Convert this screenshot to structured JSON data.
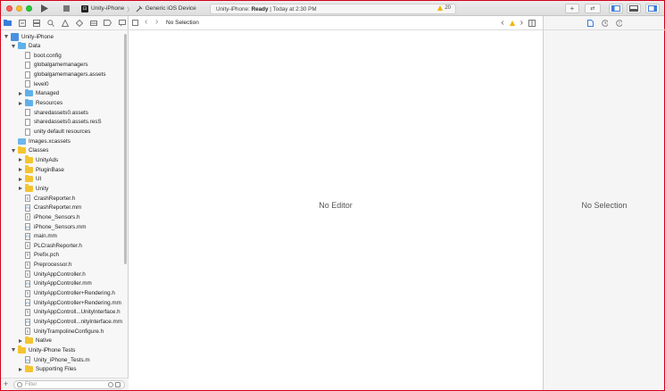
{
  "toolbar": {
    "scheme_target": "Unity-iPhone",
    "scheme_device": "Generic iOS Device",
    "status_app": "Unity-iPhone:",
    "status_state": "Ready",
    "status_time": "Today at 2:30 PM",
    "warning_count": "20"
  },
  "navigator": {
    "filter_placeholder": "Filter",
    "tree": [
      {
        "label": "Unity-iPhone",
        "kind": "project",
        "indent": 0,
        "disclosure": "open"
      },
      {
        "label": "Data",
        "kind": "folder-blue",
        "indent": 1,
        "disclosure": "open"
      },
      {
        "label": "boot.config",
        "kind": "file",
        "indent": 2,
        "disclosure": "none"
      },
      {
        "label": "globalgamemanagers",
        "kind": "file",
        "indent": 2,
        "disclosure": "none"
      },
      {
        "label": "globalgamemanagers.assets",
        "kind": "file",
        "indent": 2,
        "disclosure": "none"
      },
      {
        "label": "level0",
        "kind": "file",
        "indent": 2,
        "disclosure": "none"
      },
      {
        "label": "Managed",
        "kind": "folder-blue",
        "indent": 2,
        "disclosure": "closed"
      },
      {
        "label": "Resources",
        "kind": "folder-blue",
        "indent": 2,
        "disclosure": "closed"
      },
      {
        "label": "sharedassets0.assets",
        "kind": "file",
        "indent": 2,
        "disclosure": "none"
      },
      {
        "label": "sharedassets0.assets.resS",
        "kind": "file",
        "indent": 2,
        "disclosure": "none"
      },
      {
        "label": "unity default resources",
        "kind": "file",
        "indent": 2,
        "disclosure": "none"
      },
      {
        "label": "Images.xcassets",
        "kind": "xcassets",
        "indent": 1,
        "disclosure": "none"
      },
      {
        "label": "Classes",
        "kind": "folder-yellow",
        "indent": 1,
        "disclosure": "open"
      },
      {
        "label": "UnityAds",
        "kind": "folder-yellow",
        "indent": 2,
        "disclosure": "closed"
      },
      {
        "label": "PluginBase",
        "kind": "folder-yellow",
        "indent": 2,
        "disclosure": "closed"
      },
      {
        "label": "UI",
        "kind": "folder-yellow",
        "indent": 2,
        "disclosure": "closed"
      },
      {
        "label": "Unity",
        "kind": "folder-yellow",
        "indent": 2,
        "disclosure": "closed"
      },
      {
        "label": "CrashReporter.h",
        "kind": "h",
        "indent": 2,
        "disclosure": "none"
      },
      {
        "label": "CrashReporter.mm",
        "kind": "m",
        "indent": 2,
        "disclosure": "none"
      },
      {
        "label": "iPhone_Sensors.h",
        "kind": "h",
        "indent": 2,
        "disclosure": "none"
      },
      {
        "label": "iPhone_Sensors.mm",
        "kind": "m",
        "indent": 2,
        "disclosure": "none"
      },
      {
        "label": "main.mm",
        "kind": "m",
        "indent": 2,
        "disclosure": "none"
      },
      {
        "label": "PLCrashReporter.h",
        "kind": "h",
        "indent": 2,
        "disclosure": "none"
      },
      {
        "label": "Prefix.pch",
        "kind": "h",
        "indent": 2,
        "disclosure": "none"
      },
      {
        "label": "Preprocessor.h",
        "kind": "h",
        "indent": 2,
        "disclosure": "none"
      },
      {
        "label": "UnityAppController.h",
        "kind": "h",
        "indent": 2,
        "disclosure": "none"
      },
      {
        "label": "UnityAppController.mm",
        "kind": "m",
        "indent": 2,
        "disclosure": "none"
      },
      {
        "label": "UnityAppController+Rendering.h",
        "kind": "h",
        "indent": 2,
        "disclosure": "none"
      },
      {
        "label": "UnityAppController+Rendering.mm",
        "kind": "m",
        "indent": 2,
        "disclosure": "none"
      },
      {
        "label": "UnityAppControll...UnityInterface.h",
        "kind": "h",
        "indent": 2,
        "disclosure": "none"
      },
      {
        "label": "UnityAppControll...nityInterface.mm",
        "kind": "m",
        "indent": 2,
        "disclosure": "none"
      },
      {
        "label": "UnityTrampolineConfigure.h",
        "kind": "h",
        "indent": 2,
        "disclosure": "none"
      },
      {
        "label": "Native",
        "kind": "folder-yellow",
        "indent": 2,
        "disclosure": "closed"
      },
      {
        "label": "Unity-iPhone Tests",
        "kind": "folder-yellow",
        "indent": 1,
        "disclosure": "open"
      },
      {
        "label": "Unity_iPhone_Tests.m",
        "kind": "m",
        "indent": 2,
        "disclosure": "none"
      },
      {
        "label": "Supporting Files",
        "kind": "folder-yellow",
        "indent": 2,
        "disclosure": "closed"
      }
    ]
  },
  "editor": {
    "jump_title": "No Selection",
    "empty_label": "No Editor"
  },
  "inspector": {
    "empty_label": "No Selection"
  },
  "colors": {
    "accent": "#4a90e2",
    "warning": "#f2b400",
    "folder_blue": "#5fb0e8",
    "folder_yellow": "#f4c430"
  }
}
